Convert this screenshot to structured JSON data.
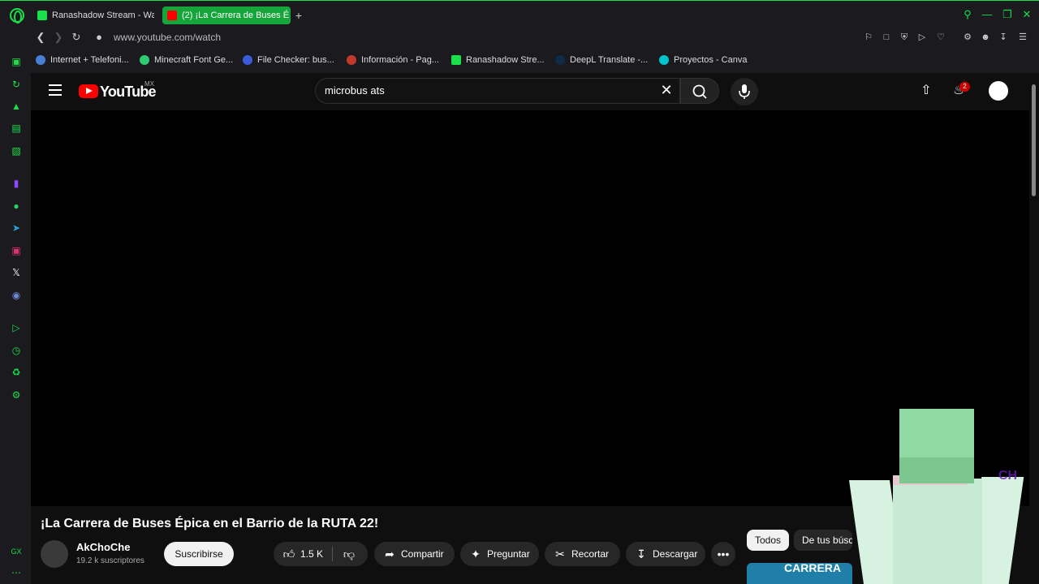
{
  "browser": {
    "tabs": [
      {
        "label": "Ranashadow Stream - Watc",
        "icon": "kick-icon",
        "active": false
      },
      {
        "label": "(2) ¡La Carrera de Buses É",
        "icon": "youtube-icon",
        "active": true
      }
    ],
    "new_tab": "+",
    "url": "www.youtube.com/watch",
    "bookmarks": [
      {
        "label": "Internet + Telefoni...",
        "icon": "telmex-icon"
      },
      {
        "label": "Minecraft Font Ge...",
        "icon": "font-icon"
      },
      {
        "label": "File Checker: bus...",
        "icon": "file-checker-icon"
      },
      {
        "label": "Información - Pag...",
        "icon": "info-icon"
      },
      {
        "label": "Ranashadow Stre...",
        "icon": "kick-icon"
      },
      {
        "label": "DeepL Translate -...",
        "icon": "deepl-icon"
      },
      {
        "label": "Proyectos - Canva",
        "icon": "canva-icon"
      }
    ],
    "sidebar_bottom_label": "GX",
    "accent": "#19e04a"
  },
  "youtube": {
    "logo_text": "YouTube",
    "region": "MX",
    "search_value": "microbus ats",
    "notification_count": "2",
    "video": {
      "title": "¡La Carrera de Buses Épica en el Barrio de la RUTA 22!",
      "channel": "AkChoChe",
      "subscribers": "19.2 k suscriptores",
      "subscribe_label": "Suscribirse",
      "likes": "1.5 K",
      "share_label": "Compartir",
      "ask_label": "Preguntar",
      "clip_label": "Recortar",
      "download_label": "Descargar",
      "more_label": "•••"
    },
    "chips": [
      "Todos",
      "De tus búsq"
    ],
    "thumbnail_text": "CARRERA"
  },
  "overlay": {
    "watermark": "CH"
  }
}
